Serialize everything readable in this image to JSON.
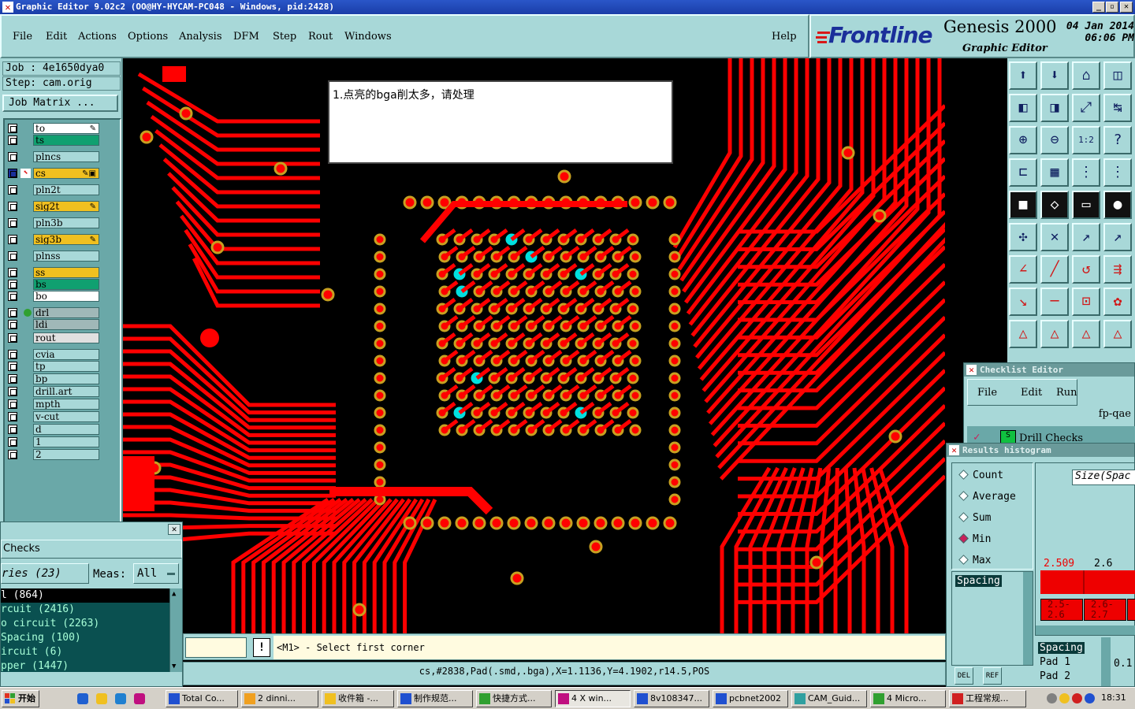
{
  "window": {
    "title": "Graphic Editor 9.02c2  (OO@HY-HYCAM-PC048 - Windows, pid:2428)"
  },
  "menu": {
    "items": [
      "File",
      "Edit",
      "Actions",
      "Options",
      "Analysis",
      "DFM",
      "Step",
      "Rout",
      "Windows"
    ],
    "help": "Help"
  },
  "brand": {
    "logo": "Frontline",
    "product": "Genesis 2000",
    "subtitle": "Graphic Editor",
    "date": "04 Jan 2014",
    "time": "06:06 PM"
  },
  "job": {
    "job_label": "Job : 4e1650dya0",
    "step_label": "Step: cam.orig",
    "matrix_button": "Job Matrix ..."
  },
  "layers": [
    {
      "name": "to",
      "bg": "#ffffff",
      "mark": "pen"
    },
    {
      "name": "ts",
      "bg": "#10a070",
      "mark": ""
    },
    {
      "name": "plncs",
      "bg": "#a8d8d8",
      "mark": ""
    },
    {
      "name": "cs",
      "bg": "#f0c020",
      "mark": "pen-box",
      "active": true
    },
    {
      "name": "pln2t",
      "bg": "#a8d8d8",
      "mark": ""
    },
    {
      "name": "sig2t",
      "bg": "#f0c020",
      "mark": "pen"
    },
    {
      "name": "pln3b",
      "bg": "#a8d8d8",
      "mark": ""
    },
    {
      "name": "sig3b",
      "bg": "#f0c020",
      "mark": "pen"
    },
    {
      "name": "plnss",
      "bg": "#a8d8d8",
      "mark": ""
    },
    {
      "name": "ss",
      "bg": "#f0c020",
      "mark": ""
    },
    {
      "name": "bs",
      "bg": "#10a070",
      "mark": ""
    },
    {
      "name": "bo",
      "bg": "#ffffff",
      "mark": ""
    },
    {
      "name": "drl",
      "bg": "#a0b8b8",
      "mark": "",
      "dot": true
    },
    {
      "name": "ldi",
      "bg": "#a0b8b8",
      "mark": ""
    },
    {
      "name": "rout",
      "bg": "#e0e0e0",
      "mark": ""
    },
    {
      "name": "cvia",
      "bg": "#a8d8d8",
      "mark": ""
    },
    {
      "name": "tp",
      "bg": "#a8d8d8",
      "mark": ""
    },
    {
      "name": "bp",
      "bg": "#a8d8d8",
      "mark": ""
    },
    {
      "name": "drill.art",
      "bg": "#a8d8d8",
      "mark": ""
    },
    {
      "name": "mpth",
      "bg": "#a8d8d8",
      "mark": ""
    },
    {
      "name": "v-cut",
      "bg": "#a8d8d8",
      "mark": ""
    },
    {
      "name": "d",
      "bg": "#a8d8d8",
      "mark": ""
    },
    {
      "name": "1",
      "bg": "#a8d8d8",
      "mark": ""
    },
    {
      "name": "2",
      "bg": "#a8d8d8",
      "mark": ""
    }
  ],
  "canvas": {
    "note": "1.点亮的bga削太多，请处理"
  },
  "checklist_editor": {
    "title": "Checklist Editor",
    "menu": [
      "File",
      "Edit",
      "Run"
    ],
    "name": "fp-qae",
    "row": "Drill Checks"
  },
  "histogram": {
    "title": "Results histogram",
    "options": [
      {
        "label": "Count",
        "selected": false
      },
      {
        "label": "Average",
        "selected": false
      },
      {
        "label": "Sum",
        "selected": false
      },
      {
        "label": "Min",
        "selected": true
      },
      {
        "label": "Max",
        "selected": false
      }
    ],
    "list_item": "Spacing",
    "size_field": "Size(Spac",
    "bar_labels": [
      "2.509",
      "2.6"
    ],
    "bin_labels": [
      "2.5-\n2.6",
      "2.6-\n2.7"
    ],
    "detail_header": "Spacing",
    "detail_rows": [
      "Pad 1",
      "Pad 2"
    ],
    "detail_value": "0.1",
    "btn_del": "DEL",
    "btn_ref": "REF"
  },
  "checks": {
    "title": "Checks",
    "categories": "ries (23)",
    "meas_label": "Meas:",
    "meas_value": "All",
    "rows": [
      "l (864)",
      "rcuit (2416)",
      "o circuit (2263)",
      "Spacing (100)",
      "ircuit (6)",
      "pper (1447)"
    ]
  },
  "command": {
    "prompt": "<M1> - Select first corner",
    "status": "cs,#2838,Pad(.smd,.bga),X=1.1136,Y=4.1902,r14.5,POS"
  },
  "taskbar": {
    "start": "开始",
    "tasks": [
      "Total Co...",
      "2 dinni...",
      "收件箱 -...",
      "制作规范...",
      "快捷方式...",
      "4 X win...",
      "8v108347...",
      "pcbnet2002",
      "CAM_Guid...",
      "4 Micro...",
      "工程常规..."
    ],
    "clock": "18:31"
  },
  "colors": {
    "panel": "#a8d8d8",
    "copper": "#ff0000",
    "highlight": "#00e0e0",
    "pad_ring": "#c8a020"
  }
}
